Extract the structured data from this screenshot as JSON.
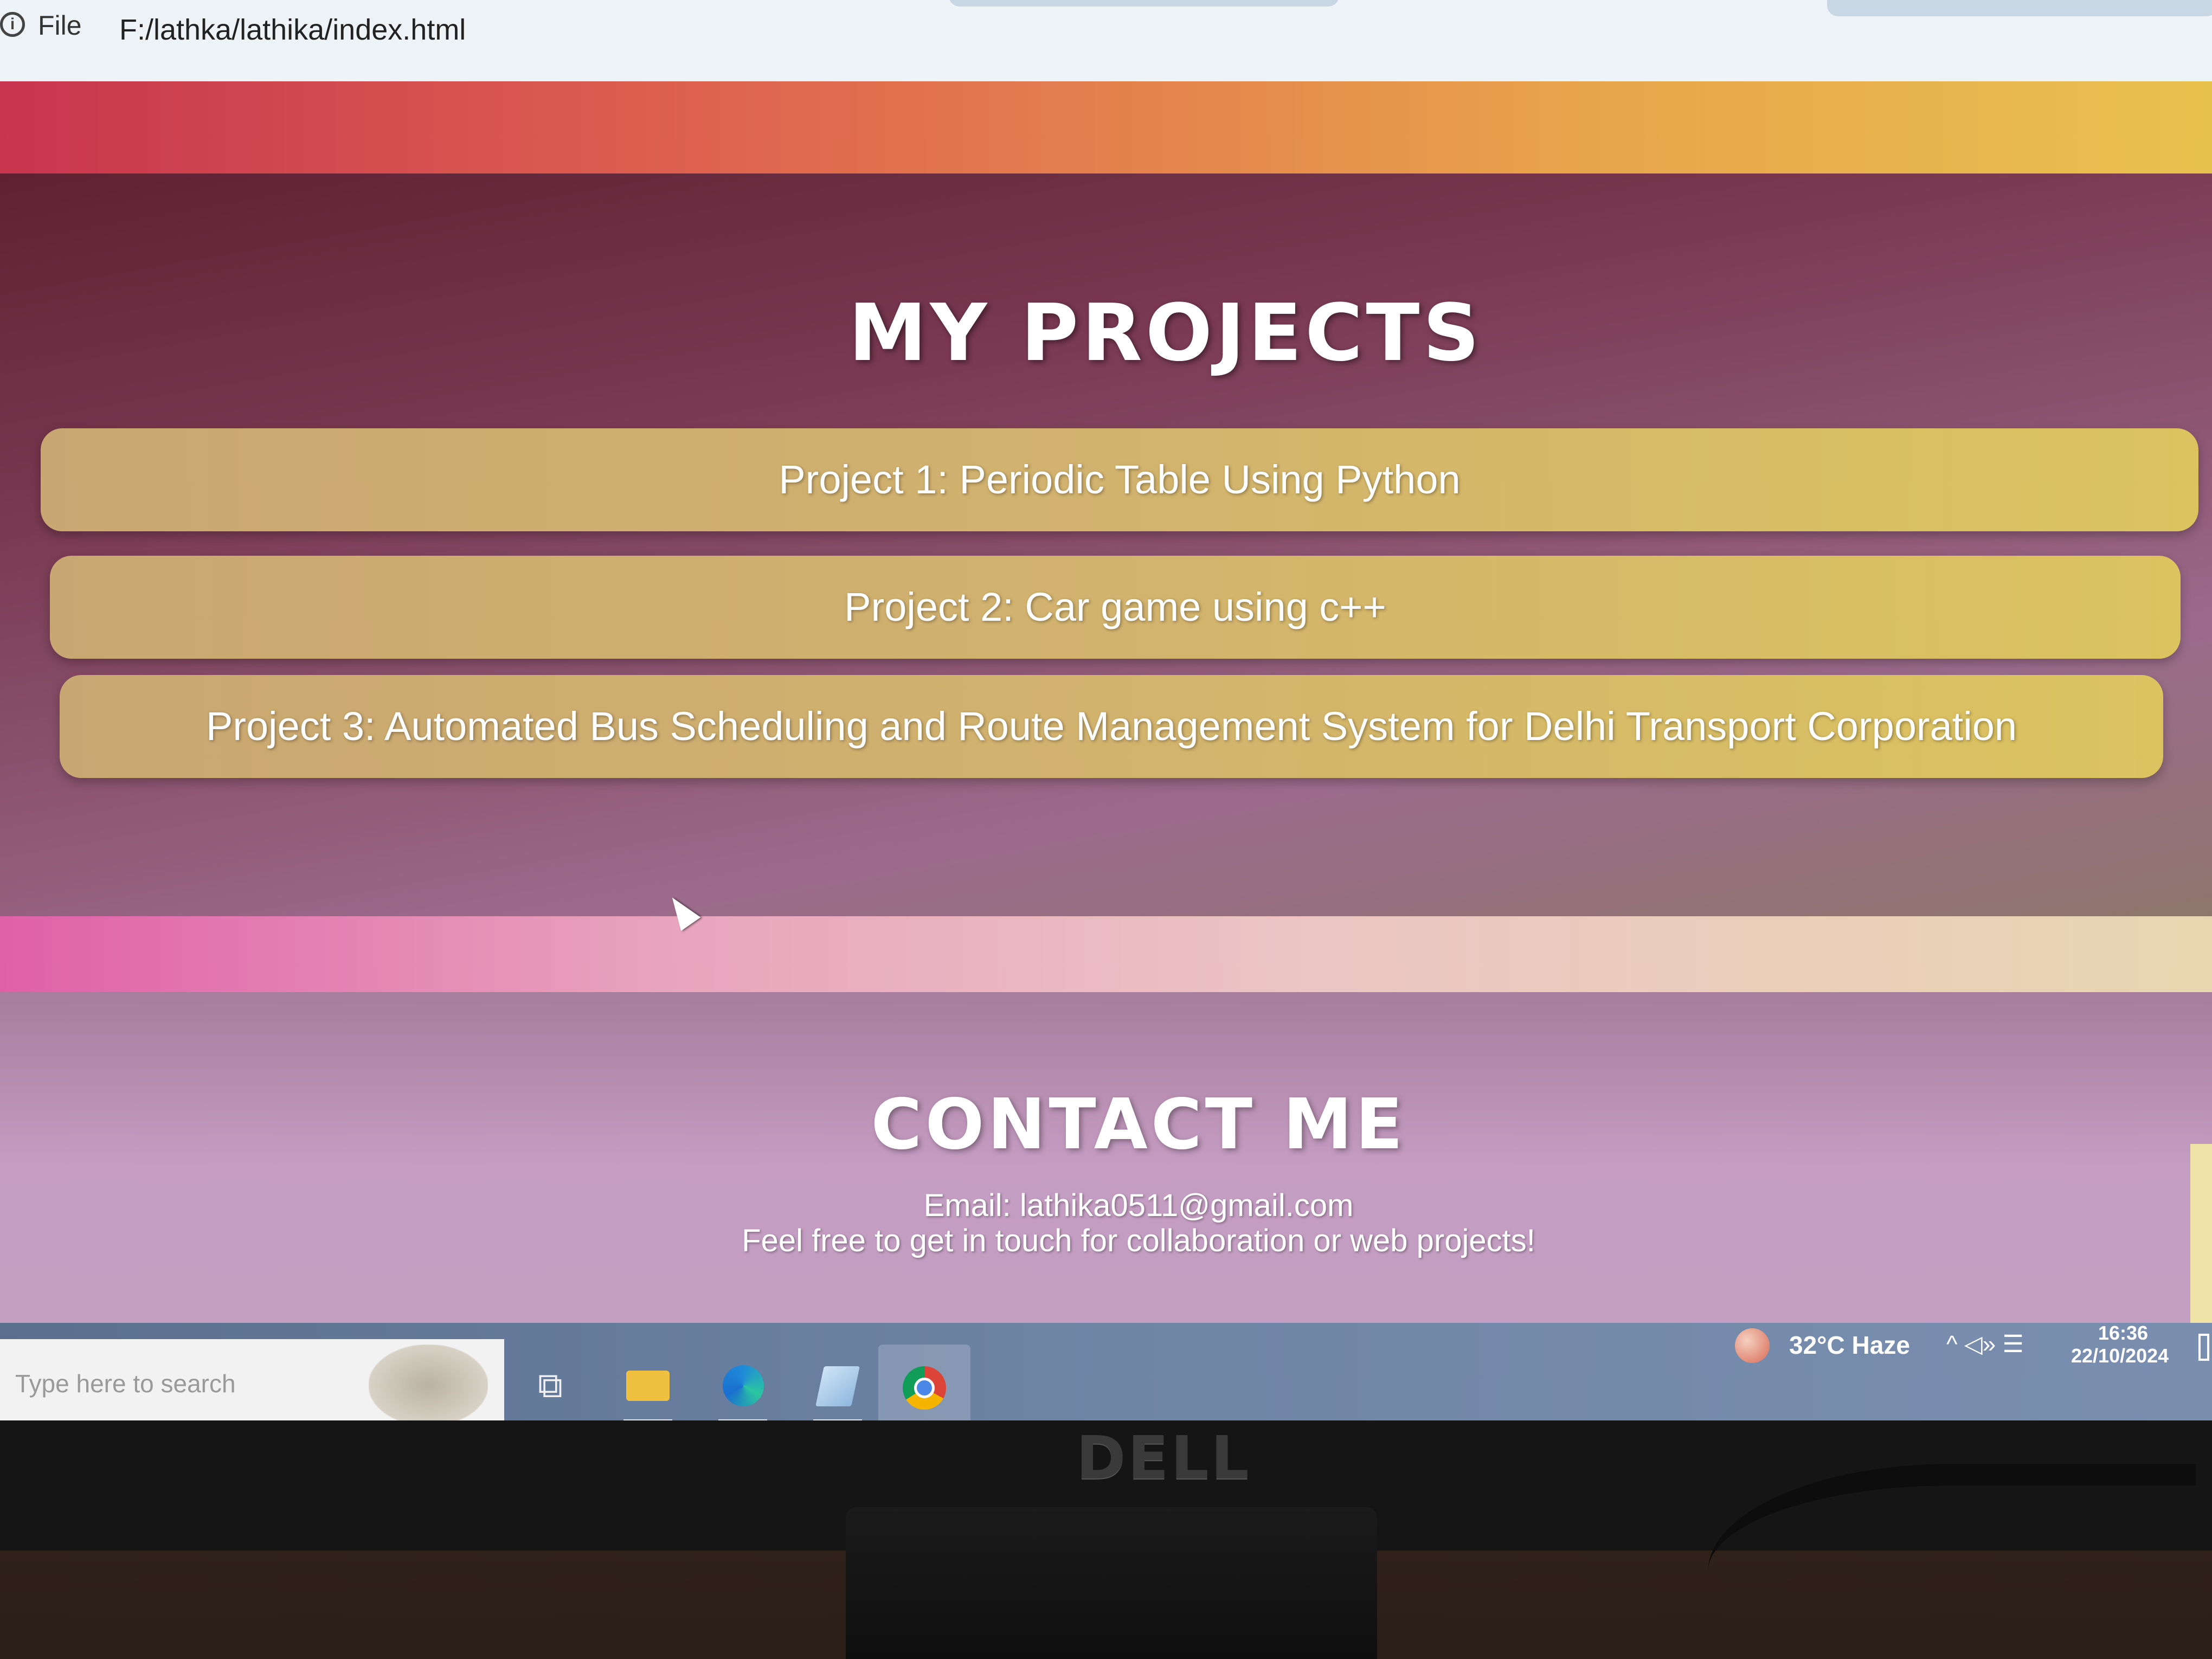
{
  "browser": {
    "info_icon": "info-icon",
    "scheme_label": "File",
    "url": "F:/lathka/lathika/index.html"
  },
  "projects": {
    "title": "MY PROJECTS",
    "items": [
      {
        "label": "Project 1: Periodic Table Using Python"
      },
      {
        "label": "Project 2: Car game using c++"
      },
      {
        "label": "Project 3: Automated Bus Scheduling and Route Management System for Delhi Transport Corporation"
      }
    ]
  },
  "contact": {
    "title": "CONTACT ME",
    "email_line": "Email: lathika0511@gmail.com",
    "note": "Feel free to get in touch for collaboration or web projects!"
  },
  "taskbar": {
    "search_placeholder": "Type here to search",
    "taskview_glyph": "⧉",
    "apps": [
      "task-view-icon",
      "file-explorer-icon",
      "edge-icon",
      "notepad-icon",
      "chrome-icon"
    ],
    "weather": "32°C  Haze",
    "tray_glyphs": "^  ◁»  ☰",
    "time": "16:36",
    "date": "22/10/2024"
  },
  "monitor": {
    "brand": "DELL"
  },
  "colors": {
    "header_band": "#e0674f",
    "card_fill": "#d2b36e",
    "section_bg": "#7a3a52",
    "contact_bg": "#c59dc3",
    "taskbar": "#6f85a6"
  }
}
